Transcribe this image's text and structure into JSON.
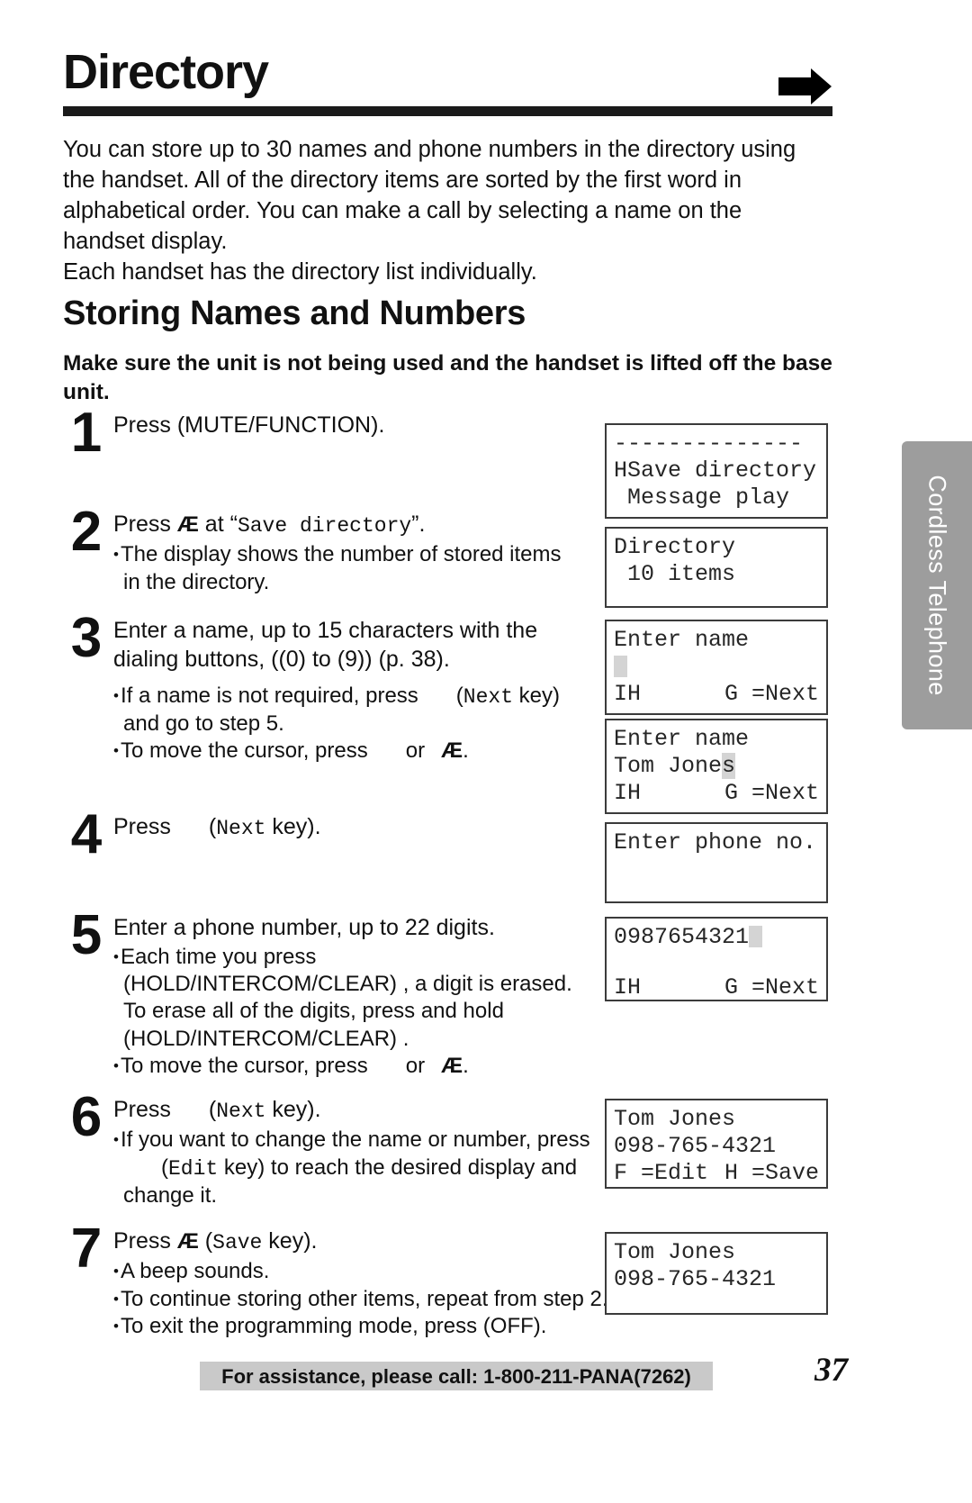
{
  "header": {
    "title": "Directory",
    "arrow_icon": "right-arrow-icon"
  },
  "side_tab": {
    "label": "Cordless Telephone",
    "color": "#9d9d9d"
  },
  "intro": {
    "paragraph1": "You can store up to 30 names and phone numbers in the directory using the handset. All of the directory items are sorted by the first word in alphabetical order. You can make a call by selecting a name on the handset display.",
    "paragraph2": "Each handset has the directory list individually."
  },
  "section": {
    "title": "Storing Names and Numbers",
    "note": "Make sure the unit is not being used and the handset is lifted off the base unit."
  },
  "steps": [
    {
      "number": "1",
      "lead_pre": "Press ",
      "lead_key": "(MUTE/FUNCTION)",
      "lead_post": ".",
      "bullets": []
    },
    {
      "number": "2",
      "lead_pre": "Press ",
      "lead_sym": "Æ",
      "lead_mid": " at “",
      "lead_mono": "Save directory",
      "lead_post": "”.",
      "bullets": [
        {
          "text": "The display shows the number of stored items",
          "cont": "in the directory."
        }
      ]
    },
    {
      "number": "3",
      "lead_line1": "Enter a name, up to 15 characters with the",
      "lead_line2_pre": "dialing buttons, ",
      "lead_line2_keys": "((0) to (9))",
      "lead_line2_post": " (p. 38).",
      "bullets": [
        {
          "pre": "If a name is not required, press",
          "mono": "Next",
          "post": " key)",
          "paren_open": "(",
          "cont": "and go to step 5."
        },
        {
          "pre": "To move the cursor, press",
          "mid": "or",
          "sym": "Æ",
          "post": "."
        }
      ]
    },
    {
      "number": "4",
      "lead_pre": "Press",
      "lead_paren_open": "(",
      "lead_mono": "Next",
      "lead_post": " key).",
      "bullets": []
    },
    {
      "number": "5",
      "lead_line1": "Enter a phone number, up to 22 digits.",
      "bullets": [
        {
          "text": "Each time you press",
          "cont1": "(HOLD/INTERCOM/CLEAR) , a digit is erased.",
          "cont2": "To erase all of the digits, press and hold",
          "cont3": "(HOLD/INTERCOM/CLEAR) ."
        },
        {
          "pre": "To move the cursor, press",
          "mid": "or",
          "sym": "Æ",
          "post": "."
        }
      ]
    },
    {
      "number": "6",
      "lead_pre": "Press",
      "lead_paren_open": "(",
      "lead_mono": "Next",
      "lead_post": " key).",
      "bullets": [
        {
          "text": "If you want to change the name or number, press",
          "cont1_mono": "Edit",
          "cont1_pre": "(",
          "cont1_post": " key) to reach the desired display and",
          "cont2": "change it."
        }
      ]
    },
    {
      "number": "7",
      "lead_pre": "Press ",
      "lead_sym": "Æ",
      "lead_paren_open": " (",
      "lead_mono": "Save",
      "lead_post": " key).",
      "bullets": [
        {
          "text": "A beep sounds."
        },
        {
          "text": "To continue storing other items, repeat from step 2."
        },
        {
          "text": "To exit the programming mode, press (OFF)."
        }
      ]
    }
  ],
  "displays": [
    {
      "id": "display-save-directory",
      "lines": [
        "--------------",
        "HSave directory",
        " Message play"
      ]
    },
    {
      "id": "display-directory-count",
      "line1": "Directory",
      "line2": " 10 items"
    },
    {
      "id": "display-enter-name-empty",
      "line1": "Enter name",
      "line2": "",
      "status_left": "IH",
      "status_right": "G =Next"
    },
    {
      "id": "display-enter-name-tom",
      "line1": "Enter name",
      "line2_text": "Tom Jone",
      "line2_cursor_char": "s",
      "status_left": "IH",
      "status_right": "G =Next"
    },
    {
      "id": "display-enter-phone",
      "line1": "Enter phone no."
    },
    {
      "id": "display-phone-number",
      "line1": "0987654321",
      "status_left": "IH",
      "status_right": "G =Next"
    },
    {
      "id": "display-confirm",
      "line1": "Tom Jones",
      "line2": "098-765-4321",
      "status_left": "F =Edit",
      "status_right": "H =Save"
    },
    {
      "id": "display-saved",
      "line1": "Tom Jones",
      "line2": "098-765-4321"
    }
  ],
  "footer": {
    "assistance": "For assistance, please call: 1-800-211-PANA(7262)",
    "page_number": "37"
  }
}
